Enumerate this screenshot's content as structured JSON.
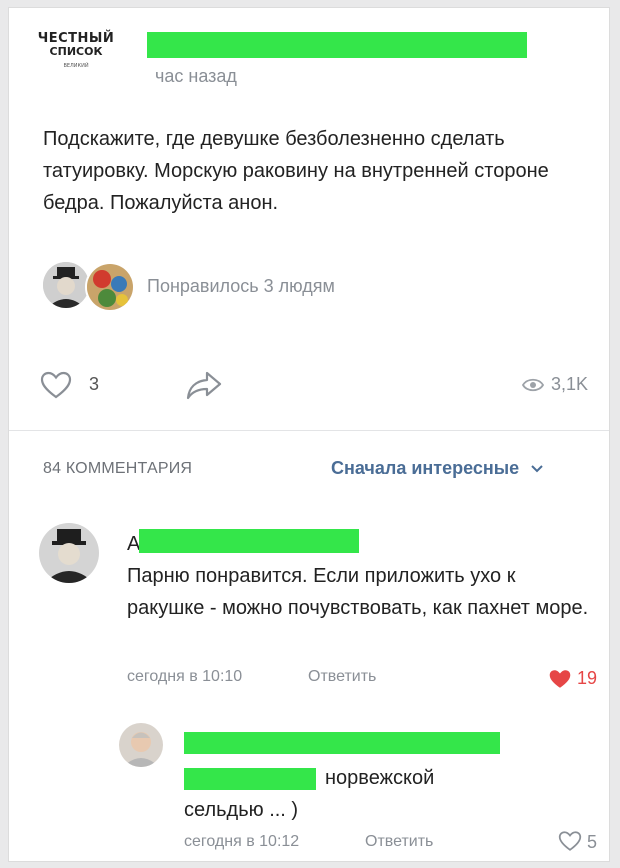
{
  "post": {
    "logo": {
      "line1": "ЧЕСТНЫЙ",
      "line2": "СПИСОК",
      "line3": "ВЕЛИКИЙ"
    },
    "time": "час назад",
    "text": "Подскажите, где девушке безболезненно сделать татуировку. Морскую раковину на внутренней стороне бедра. Пожалуйста анон.",
    "liked_by": "Понравилось 3 людям",
    "likes": "3",
    "views": "3,1K"
  },
  "comments_section": {
    "count_label": "84 КОММЕНТАРИЯ",
    "sort_label": "Сначала интересные"
  },
  "comments": [
    {
      "author_initial": "А",
      "text": "Парню понравится. Если приложить ухо к ракушке - можно почувствовать, как пахнет море.",
      "time": "сегодня в 10:10",
      "reply_label": "Ответить",
      "likes": "19",
      "liked": true
    },
    {
      "text_visible": "норвежской",
      "text_line2": "сельдью ... )",
      "time": "сегодня в 10:12",
      "reply_label": "Ответить",
      "likes": "5",
      "liked": false
    }
  ],
  "colors": {
    "accent": "#4a6d96",
    "heart": "#e64646",
    "redaction": "#34e64a"
  }
}
